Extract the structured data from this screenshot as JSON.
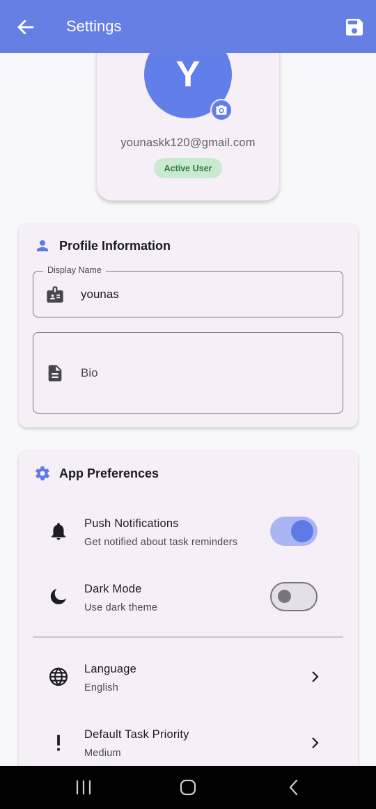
{
  "appbar": {
    "title": "Settings",
    "back_icon": "arrow-back-icon",
    "save_icon": "save-icon",
    "color": "#657fe5"
  },
  "profile": {
    "avatar_letter": "Y",
    "email": "younaskk120@gmail.com",
    "status": "Active User",
    "camera_icon": "camera-icon"
  },
  "profile_info": {
    "title": "Profile Information",
    "icon": "person-icon",
    "display_name": {
      "label": "Display Name",
      "value": "younas",
      "icon": "badge-icon"
    },
    "bio": {
      "placeholder": "Bio",
      "icon": "document-icon"
    }
  },
  "app_preferences": {
    "title": "App Preferences",
    "icon": "gear-icon",
    "items": [
      {
        "title": "Push Notifications",
        "subtitle": "Get notified about task reminders",
        "icon": "bell-icon",
        "control": "switch",
        "enabled": true
      },
      {
        "title": "Dark Mode",
        "subtitle": "Use dark theme",
        "icon": "moon-icon",
        "control": "switch",
        "enabled": false
      },
      {
        "title": "Language",
        "subtitle": "English",
        "icon": "globe-icon",
        "control": "chevron"
      },
      {
        "title": "Default Task Priority",
        "subtitle": "Medium",
        "icon": "priority-icon",
        "control": "chevron"
      }
    ]
  },
  "system_nav": {
    "buttons": [
      "recent-apps-icon",
      "home-icon",
      "back-icon"
    ]
  },
  "colors": {
    "primary": "#657fe5",
    "card_bg": "#f6eff8",
    "badge_bg": "#c9ead0",
    "badge_text": "#2b7a3c"
  }
}
